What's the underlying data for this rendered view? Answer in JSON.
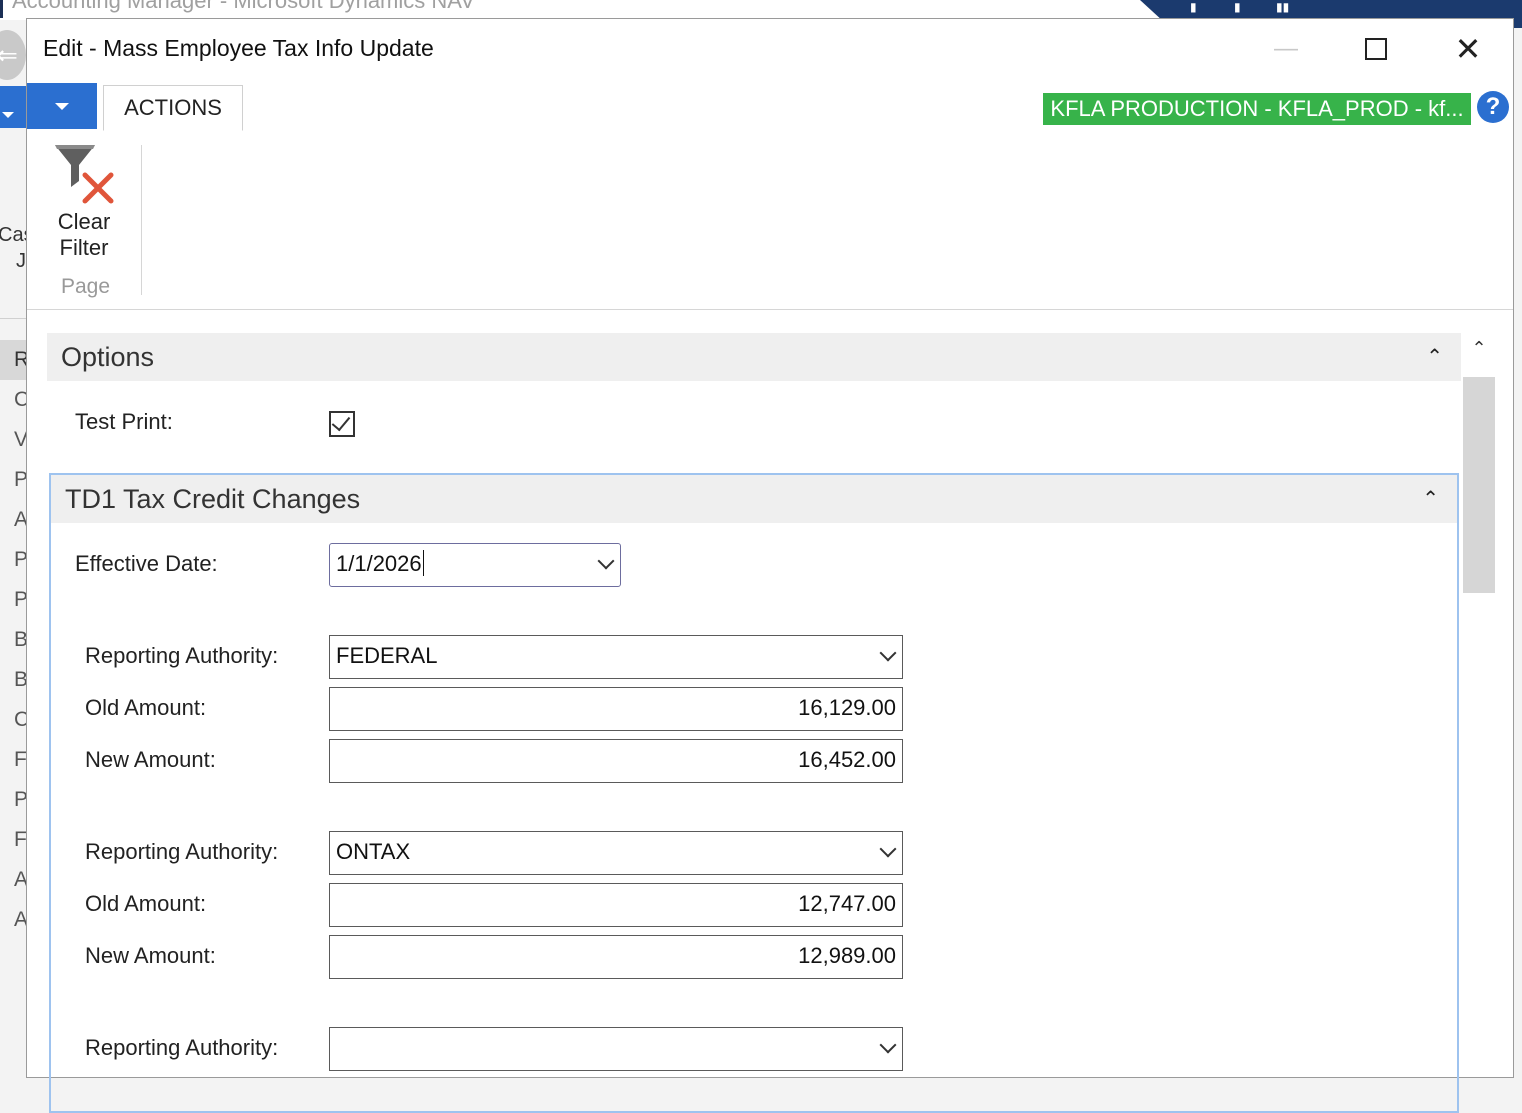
{
  "background_window": {
    "title": "Accounting Manager - Microsoft Dynamics NAV",
    "left_partial_text": [
      "Cas",
      "J"
    ],
    "left_partial_letters": [
      "R",
      "C",
      "V",
      "P",
      "A",
      "P",
      "P",
      "B",
      "B",
      "C",
      "F",
      "P",
      "F",
      "A",
      "A"
    ]
  },
  "dialog": {
    "title": "Edit - Mass Employee Tax Info Update",
    "window_controls": {
      "minimize": "—",
      "maximize": "",
      "close": "✕"
    },
    "ribbon": {
      "tab": "ACTIONS",
      "environment_badge": "KFLA PRODUCTION - KFLA_PROD - kf...",
      "environment_badge_color": "#37b34a",
      "help_icon": "?",
      "clear_filter_label_1": "Clear",
      "clear_filter_label_2": "Filter",
      "group_label": "Page"
    },
    "options": {
      "header": "Options",
      "test_print_label": "Test Print:",
      "test_print_checked": true
    },
    "td1": {
      "header": "TD1 Tax Credit Changes",
      "effective_date_label": "Effective Date:",
      "effective_date_value": "1/1/2026",
      "rows": [
        {
          "authority_label": "Reporting Authority:",
          "authority": "FEDERAL",
          "old_label": "Old Amount:",
          "old": "16,129.00",
          "new_label": "New Amount:",
          "new": "16,452.00"
        },
        {
          "authority_label": "Reporting Authority:",
          "authority": "ONTAX",
          "old_label": "Old Amount:",
          "old": "12,747.00",
          "new_label": "New Amount:",
          "new": "12,989.00"
        },
        {
          "authority_label": "Reporting Authority:",
          "authority": ""
        }
      ]
    }
  },
  "colors": {
    "accent_blue": "#2b6fd0",
    "section_border": "#9ec3ef",
    "navy": "#1b3a6e"
  }
}
